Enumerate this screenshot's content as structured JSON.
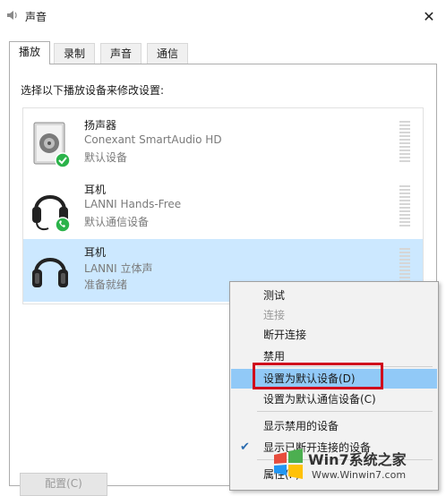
{
  "window": {
    "title": "声音",
    "close_symbol": "✕"
  },
  "tabs": [
    {
      "label": "播放",
      "active": true
    },
    {
      "label": "录制",
      "active": false
    },
    {
      "label": "声音",
      "active": false
    },
    {
      "label": "通信",
      "active": false
    }
  ],
  "instruction": "选择以下播放设备来修改设置:",
  "devices": [
    {
      "name": "扬声器",
      "description": "Conexant SmartAudio HD",
      "status": "默认设备",
      "icon": "speaker-icon",
      "badge": "check",
      "selected": false
    },
    {
      "name": "耳机",
      "description": "LANNI Hands-Free",
      "status": "默认通信设备",
      "icon": "headset-icon",
      "badge": "phone",
      "selected": false
    },
    {
      "name": "耳机",
      "description": "LANNI 立体声",
      "status": "准备就绪",
      "icon": "headphones-icon",
      "badge": "",
      "selected": true
    }
  ],
  "context_menu": {
    "items": [
      {
        "label": "测试",
        "enabled": true
      },
      {
        "label": "连接",
        "enabled": false
      },
      {
        "label": "断开连接",
        "enabled": true
      },
      {
        "label": "禁用",
        "enabled": true
      },
      {
        "label": "设置为默认设备(D)",
        "enabled": true,
        "highlighted": true
      },
      {
        "label": "设置为默认通信设备(C)",
        "enabled": true
      },
      {
        "label": "显示禁用的设备",
        "enabled": true
      },
      {
        "label": "显示已断开连接的设备",
        "enabled": true,
        "checked": true
      },
      {
        "label": "属性(P)",
        "enabled": true
      }
    ]
  },
  "buttons": {
    "configure": "配置(C)"
  },
  "watermark": {
    "brand": "Win7系统之家",
    "url": "Www.Winwin7.com"
  },
  "colors": {
    "selection": "#cce8ff",
    "menu_highlight": "#91c9f7",
    "annotation_box": "#d0021b",
    "check_badge": "#2bb34a"
  }
}
